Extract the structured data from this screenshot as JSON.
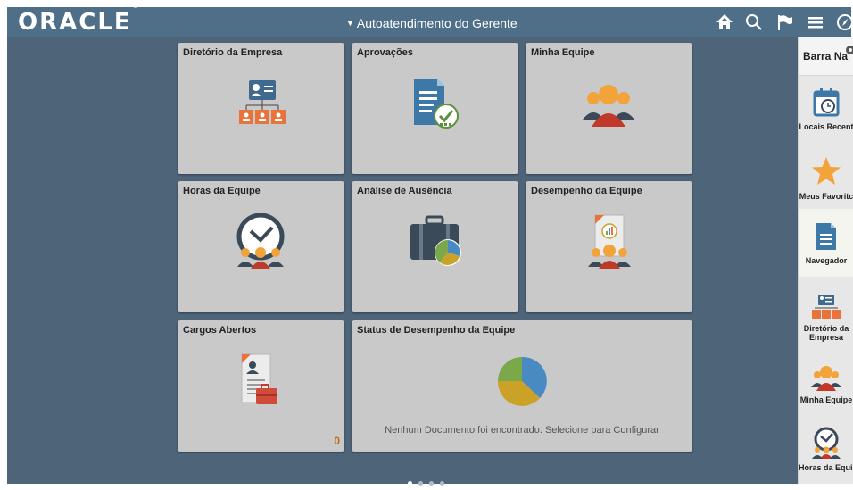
{
  "header": {
    "logo": "ORACLE",
    "title": "Autoatendimento do Gerente",
    "icons": [
      "home-icon",
      "search-icon",
      "flag-icon",
      "menu-icon",
      "compass-icon"
    ]
  },
  "tiles": {
    "diretorio": {
      "title": "Diretório da Empresa"
    },
    "aprovacoes": {
      "title": "Aprovações"
    },
    "minha_equipe": {
      "title": "Minha Equipe"
    },
    "horas": {
      "title": "Horas da Equipe"
    },
    "ausencia": {
      "title": "Análise de Ausência"
    },
    "desempenho": {
      "title": "Desempenho da Equipe"
    },
    "cargos": {
      "title": "Cargos Abertos",
      "count": "0"
    },
    "status": {
      "title": "Status de Desempenho da Equipe",
      "message": "Nenhum Documento foi encontrado. Selecione para Configurar"
    }
  },
  "pager": {
    "total": 4,
    "active": 1
  },
  "navbar": {
    "title": "Barra Na",
    "items": [
      {
        "label": "Locais Recent",
        "icon": "calendar-clock-icon"
      },
      {
        "label": "Meus Favoritc",
        "icon": "star-icon"
      },
      {
        "label": "Navegador",
        "icon": "document-icon"
      },
      {
        "label": "Diretório da Empresa",
        "icon": "org-chart-icon"
      },
      {
        "label": "Minha Equipe",
        "icon": "team-icon"
      },
      {
        "label": "Horas da Equip",
        "icon": "clock-team-icon"
      }
    ]
  },
  "colors": {
    "header": "#4f6f89",
    "background": "#4e6479",
    "tile": "#c9c9c9",
    "accent_orange": "#e8743b",
    "count": "#c26912"
  }
}
